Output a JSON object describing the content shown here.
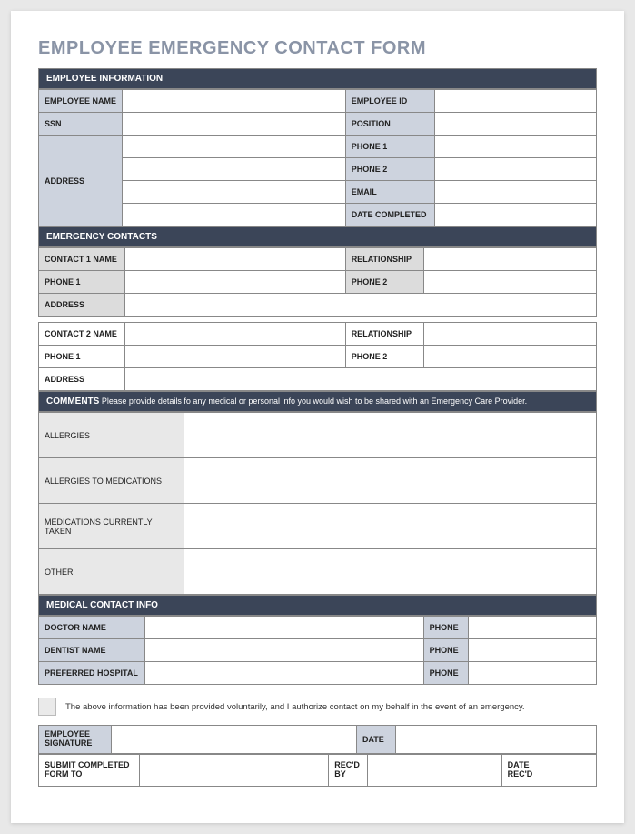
{
  "title": "EMPLOYEE EMERGENCY CONTACT FORM",
  "sections": {
    "employee_info": {
      "header": "EMPLOYEE INFORMATION",
      "employee_name": "EMPLOYEE NAME",
      "employee_id": "EMPLOYEE ID",
      "ssn": "SSN",
      "position": "POSITION",
      "address": "ADDRESS",
      "phone1": "PHONE 1",
      "phone2": "PHONE 2",
      "email": "EMAIL",
      "date_completed": "DATE COMPLETED"
    },
    "emergency": {
      "header": "EMERGENCY CONTACTS",
      "contact1_name": "CONTACT 1 NAME",
      "contact2_name": "CONTACT 2 NAME",
      "relationship": "RELATIONSHIP",
      "phone1": "PHONE 1",
      "phone2": "PHONE 2",
      "address": "ADDRESS"
    },
    "comments": {
      "header_bold": "COMMENTS",
      "header_text": " Please provide details fo any medical or personal info you would wish to be shared with an Emergency Care Provider.",
      "allergies": "ALLERGIES",
      "allergies_med": "ALLERGIES TO MEDICATIONS",
      "medications": "MEDICATIONS CURRENTLY TAKEN",
      "other": "OTHER"
    },
    "medical": {
      "header": "MEDICAL CONTACT INFO",
      "doctor": "DOCTOR NAME",
      "dentist": "DENTIST NAME",
      "hospital": "PREFERRED HOSPITAL",
      "phone": "PHONE"
    },
    "auth": {
      "text": "The above information has been provided voluntarily, and I authorize contact on my behalf in the event of an emergency."
    },
    "signature": {
      "emp_sig": "EMPLOYEE SIGNATURE",
      "date": "DATE",
      "submit": "SUBMIT COMPLETED FORM TO",
      "recd_by": "REC'D BY",
      "date_recd": "DATE REC'D"
    }
  }
}
